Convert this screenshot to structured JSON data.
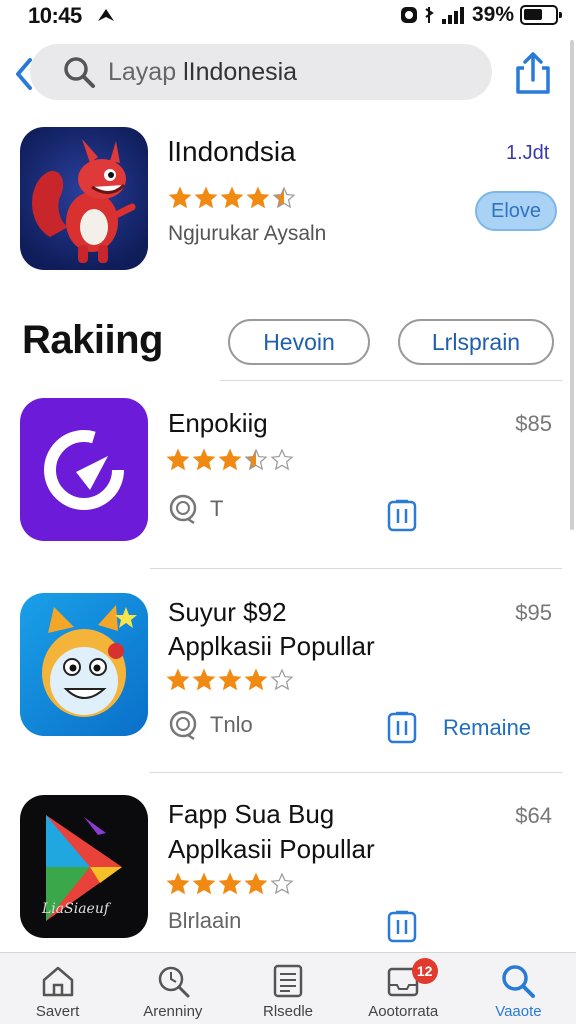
{
  "status": {
    "time": "10:45",
    "battery": "39%"
  },
  "search": {
    "placeholder": "Layap",
    "query": "lIndonesia"
  },
  "featured": {
    "name": "lIndondsia",
    "meta": "1.Jdt",
    "subtitle": "Ngjurukar Aysaln",
    "get_label": "Elove",
    "rating": 4.5,
    "colors": {
      "icon_bg": "#1a2a78",
      "character": "#d8312f"
    }
  },
  "ranking": {
    "title": "Rakiing",
    "pills": [
      "Hevoin",
      "Lrlsprain"
    ]
  },
  "apps": [
    {
      "name": "Enpokiig",
      "line2": "",
      "price": "$85",
      "meta_text": "T",
      "action": "",
      "rating": 3.5,
      "icon": "purple-swirl-icon"
    },
    {
      "name": "Suyur $92",
      "line2": "Applkasii Popullar",
      "price": "$95",
      "meta_text": "Tnlo",
      "action": "Remaine",
      "rating": 4,
      "icon": "cartoon-face-icon"
    },
    {
      "name": "Fapp Sua Bug",
      "line2": "Applkasii Popullar",
      "price": "$64",
      "meta_text": "Blrlaain",
      "action": "",
      "rating": 4,
      "icon": "play-triangle-icon"
    }
  ],
  "tabs": [
    {
      "label": "Savert",
      "icon": "home-icon"
    },
    {
      "label": "Arenniny",
      "icon": "search-magnifier-icon"
    },
    {
      "label": "Rlsedle",
      "icon": "list-icon"
    },
    {
      "label": "Aootorrata",
      "icon": "inbox-icon",
      "badge": "12"
    },
    {
      "label": "Vaaote",
      "icon": "search-icon",
      "active": true
    }
  ],
  "accent": "#2a7ad8"
}
